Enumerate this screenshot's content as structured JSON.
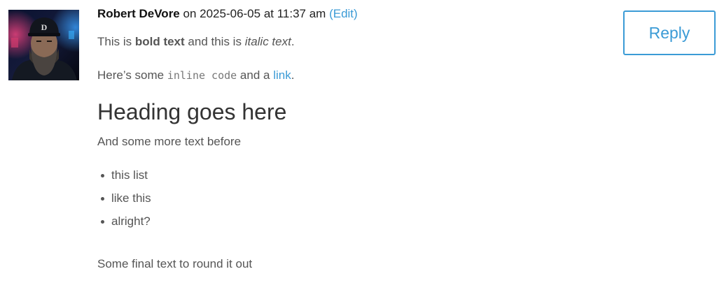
{
  "comment": {
    "author": "Robert DeVore",
    "on_text": "on 2025-06-05 at 11:37 am",
    "edit_label": "(Edit)",
    "reply_label": "Reply",
    "avatar_icon": "user-avatar-photo",
    "p1": {
      "before": "This is ",
      "bold": "bold text",
      "middle": " and this is ",
      "italic": "italic text",
      "after": "."
    },
    "p2": {
      "before": "Here’s some ",
      "code": "inline code",
      "middle": " and a ",
      "link": "link",
      "after": "."
    },
    "heading": "Heading goes here",
    "p3": "And some more text before",
    "list": [
      "this list",
      "like this",
      "alright?"
    ],
    "p4": "Some final text to round it out"
  },
  "colors": {
    "link": "#3b9bd6",
    "body_text": "#555555",
    "heading": "#333333"
  }
}
